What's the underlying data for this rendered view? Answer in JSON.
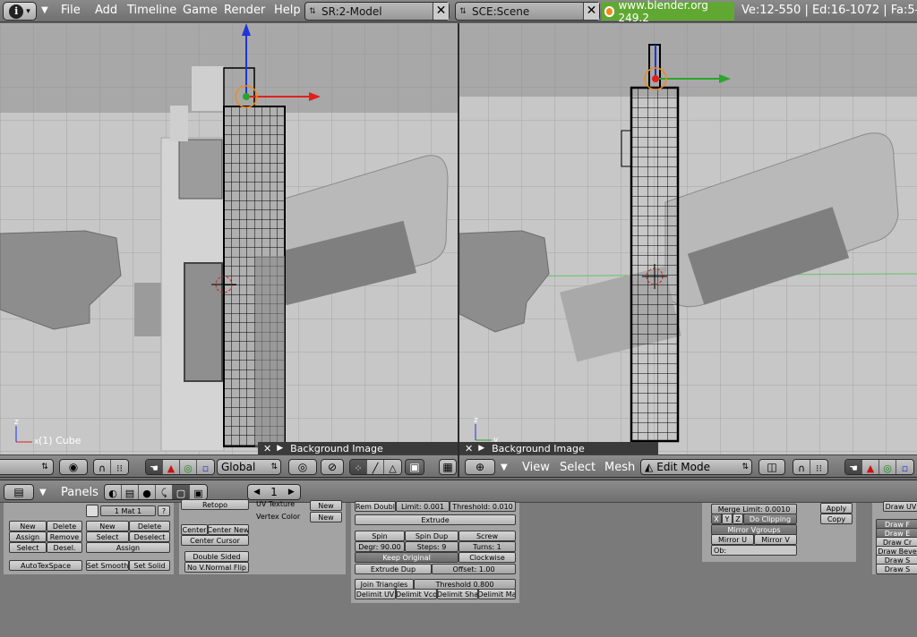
{
  "topbar": {
    "menus": [
      "File",
      "Add",
      "Timeline",
      "Game",
      "Render",
      "Help"
    ],
    "screen": "SR:2-Model",
    "scene": "SCE:Scene",
    "url": "www.blender.org 249.2",
    "stats": "Ve:12-550 | Ed:16-1072 | Fa:5-5"
  },
  "viewport_left": {
    "bg_panel_label": "Background Image",
    "object_label": "(1) Cube",
    "orientation": "Global"
  },
  "viewport_right": {
    "bg_panel_label": "Background Image",
    "menus": [
      "View",
      "Select",
      "Mesh"
    ],
    "mode": "Edit Mode"
  },
  "buttons_window": {
    "panels_label": "Panels",
    "frame": "1",
    "mat_label": "1 Mat 1",
    "link_panel": {
      "new": "New",
      "delete": "Delete",
      "assign": "Assign",
      "remove": "Remove",
      "select": "Select",
      "deselect_short": "Desel.",
      "new2": "New",
      "delete2": "Delete",
      "select2": "Select",
      "deselect2": "Deselect",
      "assign2": "Assign",
      "autotex": "AutoTexSpace",
      "set_smooth": "Set Smooth",
      "set_solid": "Set Solid"
    },
    "mesh_panel": {
      "retopo": "Retopo",
      "uv_texture": "UV Texture",
      "vertex_color": "Vertex Color",
      "new_a": "New",
      "new_b": "New",
      "center_new": "Center New",
      "center": "Center",
      "center_cursor": "Center Cursor",
      "double_sided": "Double Sided",
      "no_vnormal_flip": "No V.Normal Flip"
    },
    "tools_panel": {
      "rem_doubles": "Rem Doubl",
      "limit": "Limit: 0.001",
      "threshold": "Threshold: 0.010",
      "extrude": "Extrude",
      "spin": "Spin",
      "spin_dup": "Spin Dup",
      "screw": "Screw",
      "degr": "Degr: 90.00",
      "steps": "Steps: 9",
      "turns": "Turns: 1",
      "keep_original": "Keep Original",
      "clockwise": "Clockwise",
      "extrude_dup": "Extrude Dup",
      "offset": "Offset: 1.00",
      "join_triangles": "Join Triangles",
      "threshold2": "Threshold 0.800",
      "delimit": [
        "Delimit UV",
        "Delimit Vco",
        "Delimit Sha",
        "Delimit Ma"
      ]
    },
    "modifier_panel": {
      "merge_limit": "Merge Limit: 0.0010",
      "x": "X",
      "y": "Y",
      "z": "Z",
      "do_clipping": "Do Clipping",
      "mirror_vgroups": "Mirror Vgroups",
      "mirror_u": "Mirror U",
      "mirror_v": "Mirror V",
      "ob": "Ob:",
      "apply": "Apply",
      "copy": "Copy"
    },
    "draw_panel": {
      "items": [
        "Draw UV",
        "Draw F",
        "Draw E",
        "Draw Cr",
        "Draw Beve",
        "Draw S",
        "Draw S"
      ]
    }
  },
  "colors": {
    "bg_gray": "#9c9c9c",
    "wire": "#000000",
    "axis_x": "#e0201c",
    "axis_y": "#2ba52b",
    "axis_z": "#1f35d8",
    "url_green": "#60a832"
  }
}
